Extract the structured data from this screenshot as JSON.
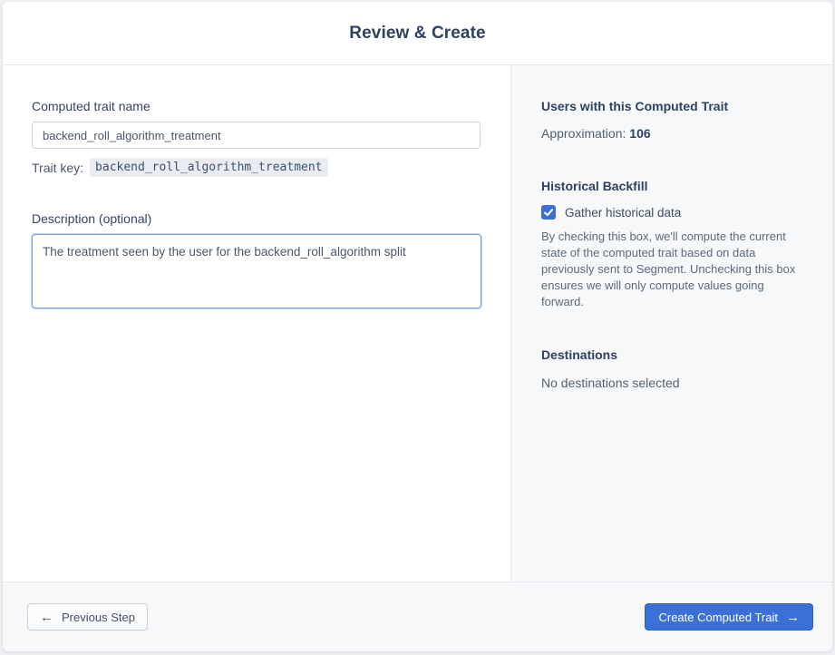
{
  "header": {
    "title": "Review & Create"
  },
  "form": {
    "name_label": "Computed trait name",
    "name_value": "backend_roll_algorithm_treatment",
    "trait_key_label": "Trait key:",
    "trait_key_value": "backend_roll_algorithm_treatment",
    "description_label": "Description (optional)",
    "description_value": "The treatment seen by the user for the backend_roll_algorithm split"
  },
  "sidebar": {
    "users_heading": "Users with this Computed Trait",
    "approximation_label": "Approximation: ",
    "approximation_value": "106",
    "backfill_heading": "Historical Backfill",
    "backfill_checkbox_label": "Gather historical data",
    "backfill_checked": true,
    "backfill_description": "By checking this box, we'll compute the current state of the computed trait based on data previously sent to Segment. Unchecking this box ensures we will only compute values going forward.",
    "destinations_heading": "Destinations",
    "destinations_empty": "No destinations selected"
  },
  "footer": {
    "previous_label": "Previous Step",
    "create_label": "Create Computed Trait"
  },
  "icons": {
    "back_arrow": "←",
    "forward_arrow": "→"
  },
  "colors": {
    "accent_blue": "#3b70d7",
    "checkbox_blue": "#3a6fd4",
    "heading_navy": "#2e4161",
    "sidebar_bg": "#f7f8fa",
    "focused_input_border": "#7da1e0"
  }
}
